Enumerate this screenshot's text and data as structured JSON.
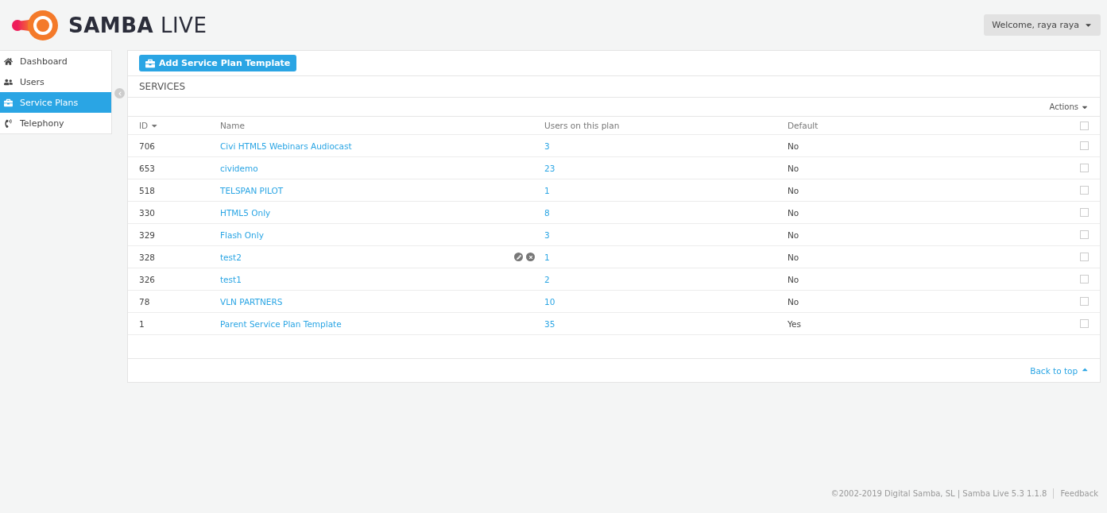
{
  "header": {
    "brand_bold": "SAMBA",
    "brand_light": "LIVE",
    "user_menu": "Welcome, raya raya"
  },
  "sidebar": {
    "items": [
      {
        "label": "Dashboard",
        "selected": false
      },
      {
        "label": "Users",
        "selected": false
      },
      {
        "label": "Service Plans",
        "selected": true
      },
      {
        "label": "Telephony",
        "selected": false
      }
    ]
  },
  "toolbar": {
    "add_button": "Add Service Plan Template"
  },
  "section_title": "SERVICES",
  "actions_menu": "Actions",
  "table": {
    "columns": [
      "ID",
      "Name",
      "Users on this plan",
      "Default"
    ],
    "header_checked": false,
    "rows": [
      {
        "id": "706",
        "name": "Civi HTML5 Webinars Audiocast",
        "users": "3",
        "default": "No",
        "hovered": false,
        "checked": false
      },
      {
        "id": "653",
        "name": "cividemo",
        "users": "23",
        "default": "No",
        "hovered": false,
        "checked": false
      },
      {
        "id": "518",
        "name": "TELSPAN PILOT",
        "users": "1",
        "default": "No",
        "hovered": false,
        "checked": false
      },
      {
        "id": "330",
        "name": "HTML5 Only",
        "users": "8",
        "default": "No",
        "hovered": false,
        "checked": false
      },
      {
        "id": "329",
        "name": "Flash Only",
        "users": "3",
        "default": "No",
        "hovered": false,
        "checked": false
      },
      {
        "id": "328",
        "name": "test2",
        "users": "1",
        "default": "No",
        "hovered": true,
        "checked": false
      },
      {
        "id": "326",
        "name": "test1",
        "users": "2",
        "default": "No",
        "hovered": false,
        "checked": false
      },
      {
        "id": "78",
        "name": "VLN PARTNERS",
        "users": "10",
        "default": "No",
        "hovered": false,
        "checked": false
      },
      {
        "id": "1",
        "name": "Parent Service Plan Template",
        "users": "35",
        "default": "Yes",
        "hovered": false,
        "checked": false
      }
    ]
  },
  "back_to_top": "Back to top",
  "footer": {
    "copyright": "©2002-2019 Digital Samba, SL | Samba Live 5.3 1.1.8",
    "feedback": "Feedback"
  }
}
